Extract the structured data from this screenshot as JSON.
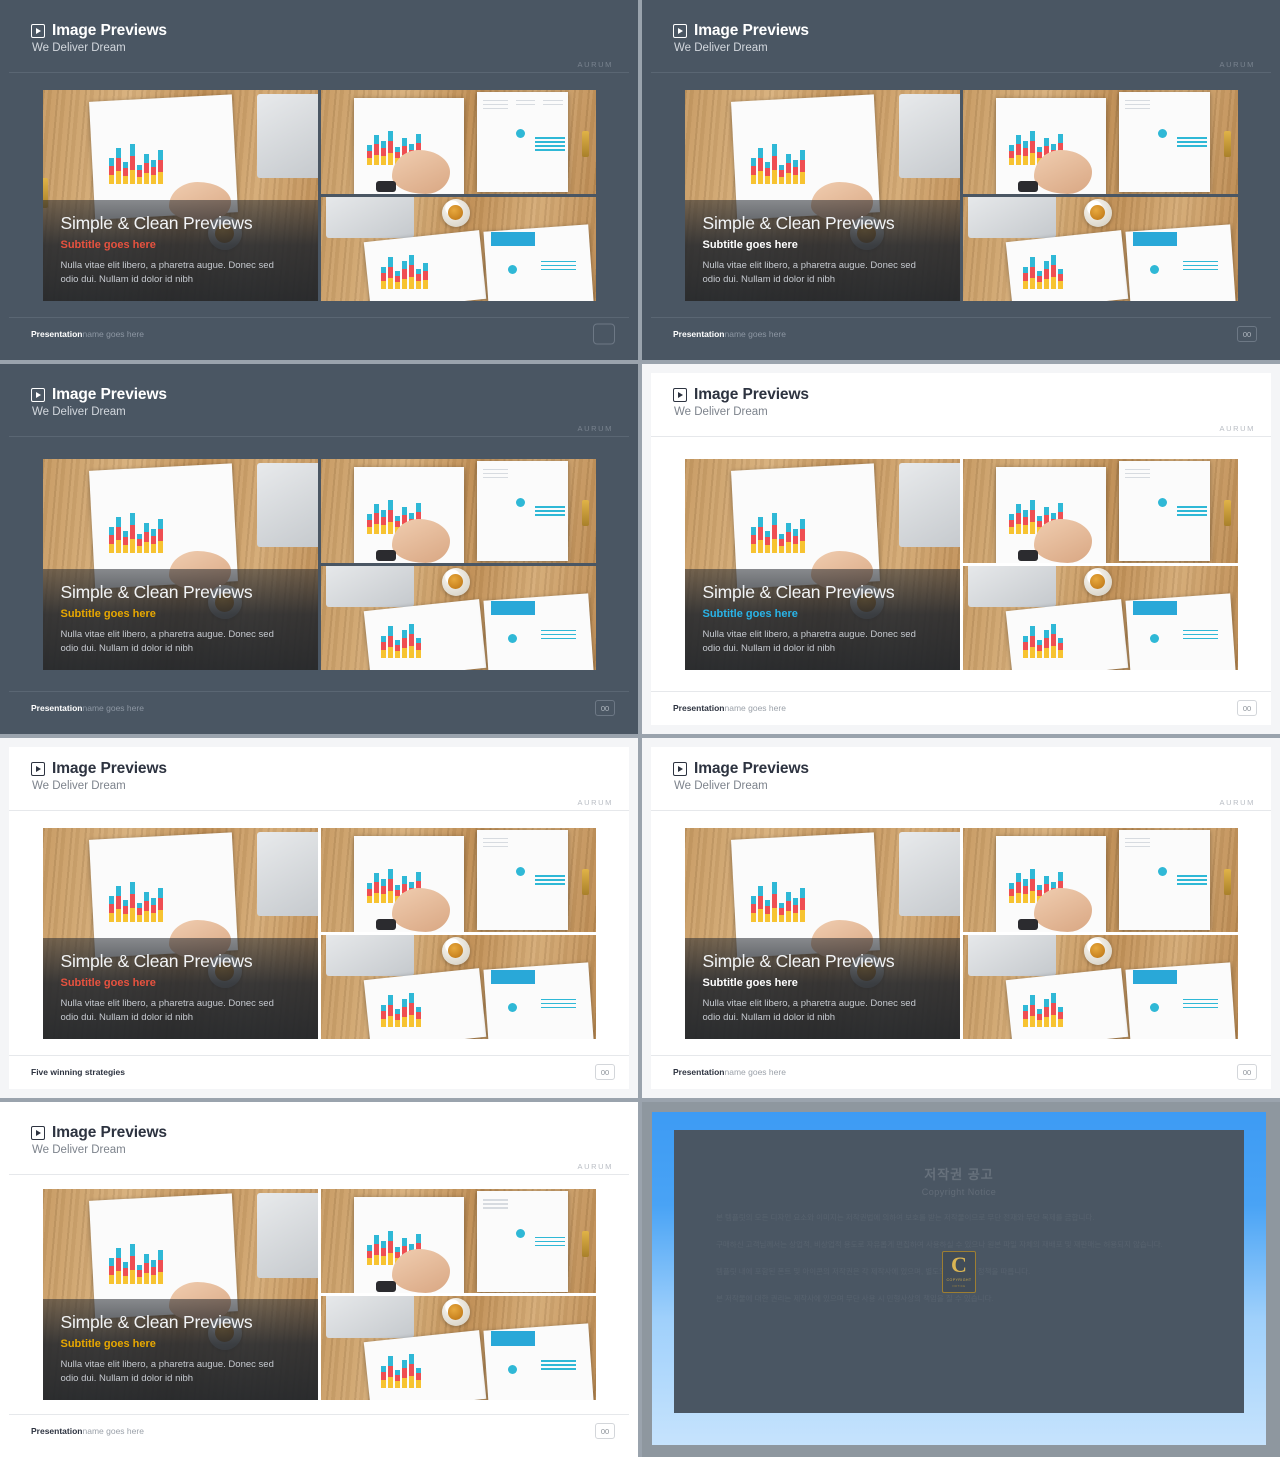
{
  "meta": {
    "header_title": "Image Previews",
    "header_subtitle": "We Deliver Dream",
    "brand": "AURUM",
    "play_icon": "play-icon"
  },
  "overlay": {
    "title": "Simple & Clean Previews",
    "subtitle": "Subtitle goes here",
    "body": "Nulla vitae elit libero, a pharetra augue. Donec sed odio dui. Nullam id dolor id nibh"
  },
  "footer": {
    "strong": "Presentation",
    "muted": " name goes here",
    "alt_strong": "Five winning strategies",
    "page": "00",
    "page_empty": ""
  },
  "colors": {
    "dark_bg": "#4a5663",
    "light_bg": "#f4f5f7",
    "accent_red": "#e8523f",
    "accent_white": "#ffffff",
    "accent_gold": "#e8a800",
    "accent_cyan": "#29b4e8",
    "brand_blue": "#3d9bf4",
    "chart_yellow": "#f7c331",
    "chart_red": "#ef4e52",
    "chart_cyan": "#2fb8d6"
  },
  "slides": [
    {
      "id": 1,
      "theme": "dark",
      "subtitle_color": "#e8523f",
      "footer_kind": "presentation",
      "page_kind": "empty"
    },
    {
      "id": 2,
      "theme": "dark",
      "subtitle_color": "#ffffff",
      "footer_kind": "presentation",
      "page_kind": "number"
    },
    {
      "id": 3,
      "theme": "dark",
      "subtitle_color": "#e8a800",
      "footer_kind": "presentation",
      "page_kind": "number"
    },
    {
      "id": 4,
      "theme": "light",
      "subtitle_color": "#29b4e8",
      "footer_kind": "presentation",
      "page_kind": "number"
    },
    {
      "id": 5,
      "theme": "light",
      "subtitle_color": "#e8523f",
      "footer_kind": "alt",
      "page_kind": "number"
    },
    {
      "id": 6,
      "theme": "light",
      "subtitle_color": "#ffffff",
      "footer_kind": "presentation",
      "page_kind": "number"
    },
    {
      "id": 7,
      "theme": "white",
      "subtitle_color": "#e8a800",
      "footer_kind": "presentation",
      "page_kind": "number"
    }
  ],
  "copyright": {
    "heading": "저작권 공고",
    "subheading": "Copyright Notice",
    "logo_letter": "C",
    "logo_label": "COPYRIGHT",
    "logo_sublabel": "NOTICE",
    "paragraphs": [
      "본 템플릿의 모든 디자인 요소와 이미지는 저작권법에 의하여 보호를 받는 저작물이므로 무단 전재와 무단 복제를 금합니다.",
      "구매하신 고객님께서는 상업적, 비상업적 용도로 자유롭게 편집하여 사용하실 수 있으나 원본 파일 자체의 재배포 및 재판매는 허용되지 않습니다.",
      "템플릿 내에 포함된 폰트 및 아이콘의 저작권은 각 제작사에 있으며, 별도의 라이선스 정책을 따릅니다.",
      "본 저작물에 대한 권리는 제작사에 있으며 무단 사용 시 민형사상의 책임을 질 수 있습니다."
    ]
  }
}
